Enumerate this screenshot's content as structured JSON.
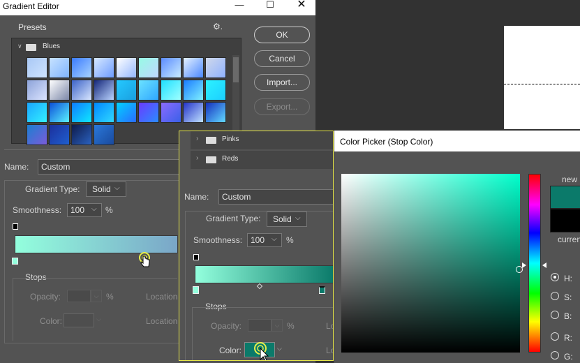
{
  "gradient_editor": {
    "title": "Gradient Editor",
    "window_controls": {
      "minimize": "—",
      "maximize": "☐",
      "close": "✕"
    },
    "presets_label": "Presets",
    "gear_icon": "⚙",
    "gear_suffix": ".",
    "folder": {
      "chevron": "∨",
      "label": "Blues"
    },
    "buttons": {
      "ok": "OK",
      "cancel": "Cancel",
      "import": "Import...",
      "export": "Export..."
    },
    "name_label": "Name:",
    "name_value": "Custom",
    "gradient_type_label": "Gradient Type:",
    "gradient_type_value": "Solid",
    "smoothness_label": "Smoothness:",
    "smoothness_value": "100",
    "percent": "%",
    "stops_label": "Stops",
    "opacity_label": "Opacity:",
    "color_label": "Color:",
    "location_label": "Location",
    "dropdown_arrow": "⌵",
    "gradient_colors": [
      "#93ffdd",
      "#7aa6c8"
    ]
  },
  "gradient_editor_foreground": {
    "folders": [
      {
        "chevron": "›",
        "label": "Pinks"
      },
      {
        "chevron": "›",
        "label": "Reds"
      }
    ],
    "name_label": "Name:",
    "name_value": "Custom",
    "gradient_type_label": "Gradient Type:",
    "gradient_type_value": "Solid",
    "smoothness_label": "Smoothness:",
    "smoothness_value": "100",
    "percent": "%",
    "stops_label": "Stops",
    "opacity_label": "Opacity:",
    "color_label": "Color:",
    "location_short": "Lo",
    "dropdown_arrow": "⌵",
    "gradient_colors": [
      "#93ffdd",
      "#0b7a6a"
    ],
    "outline_color": "#e8e84a"
  },
  "color_picker": {
    "title": "Color Picker (Stop Color)",
    "new_label": "new",
    "current_label": "curren",
    "new_color": "#0b7a6a",
    "current_color": "#000000",
    "modes": [
      {
        "label": "H:",
        "selected": true
      },
      {
        "label": "S:",
        "selected": false
      },
      {
        "label": "B:",
        "selected": false
      },
      {
        "label": "R:",
        "selected": false
      },
      {
        "label": "G:",
        "selected": false
      }
    ]
  },
  "preset_swatches": [
    [
      "#a9c8f5",
      "#cfe4ff"
    ],
    [
      "#c7e2ff",
      "#7fb4ff"
    ],
    [
      "#3b7bff",
      "#a8d4ff"
    ],
    [
      "#d6e8ff",
      "#6e9cff"
    ],
    [
      "#ffffff",
      "#94b8ff"
    ],
    [
      "#97fbe5",
      "#c0d6ff"
    ],
    [
      "#5c8cff",
      "#c8ecff"
    ],
    [
      "#e5f1ff",
      "#4a88ff"
    ],
    [
      "#cfd8ea",
      "#8fb2ff"
    ],
    [
      "#8da3d9",
      "#dbe4ff"
    ],
    [
      "#ffffff",
      "#7b87a8"
    ],
    [
      "#3c63c7",
      "#d8e6ff"
    ],
    [
      "#15277a",
      "#b9d3ff"
    ],
    [
      "#24c9ff",
      "#1a9fe0"
    ],
    [
      "#6be2ff",
      "#2ea6ff"
    ],
    [
      "#1fe0ff",
      "#9fffff"
    ],
    [
      "#1a7cff",
      "#7ff0ff"
    ],
    [
      "#2cf2ff",
      "#1ccfff"
    ],
    [
      "#19a6ff",
      "#34f0ff"
    ],
    [
      "#0c4fd8",
      "#5af2ff"
    ],
    [
      "#0f7cff",
      "#0fe8ff"
    ],
    [
      "#0088ff",
      "#30d8ff"
    ],
    [
      "#00d2ff",
      "#2a6bff"
    ],
    [
      "#6a3bff",
      "#2a8cff"
    ],
    [
      "#8b6bff",
      "#3a60e8"
    ],
    [
      "#2433c9",
      "#bfe1ff"
    ],
    [
      "#152fbf",
      "#62d9ff"
    ],
    [
      "#1b7fd1",
      "#7b5bd9"
    ],
    [
      "#1c2f9c",
      "#1f5fcf"
    ],
    [
      "#0e1a4a",
      "#2a62c0"
    ],
    [
      "#2a78d9",
      "#1a4a9e"
    ]
  ]
}
